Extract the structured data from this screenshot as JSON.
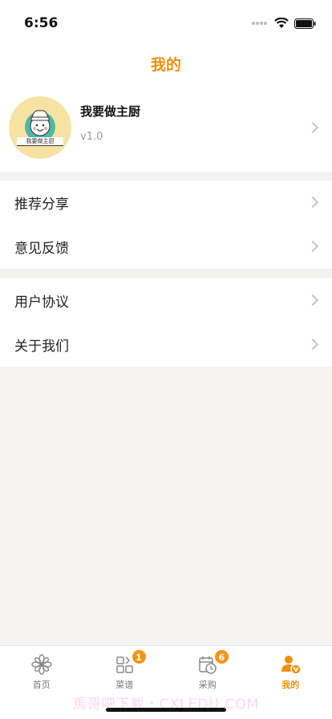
{
  "status_bar": {
    "time": "6:56"
  },
  "nav": {
    "title": "我的"
  },
  "profile": {
    "avatar_caption": "我要做主厨",
    "name": "我要做主厨",
    "version": "v1.0"
  },
  "menu_groups": [
    {
      "items": [
        {
          "label": "推荐分享"
        },
        {
          "label": "意见反馈"
        }
      ]
    },
    {
      "items": [
        {
          "label": "用户协议"
        },
        {
          "label": "关于我们"
        }
      ]
    }
  ],
  "tabbar": {
    "tabs": [
      {
        "label": "首页",
        "icon": "flower-home-icon",
        "badge": ""
      },
      {
        "label": "菜谱",
        "icon": "grid-menu-icon",
        "badge": "1"
      },
      {
        "label": "采购",
        "icon": "calendar-clock-icon",
        "badge": "6"
      },
      {
        "label": "我的",
        "icon": "user-profile-icon",
        "badge": "",
        "active": true
      }
    ]
  },
  "watermark": "馬哥吧下載・CXLEDU.COM",
  "colors": {
    "accent": "#f0900e",
    "badge": "#f39517",
    "background": "#f4f3f1"
  }
}
